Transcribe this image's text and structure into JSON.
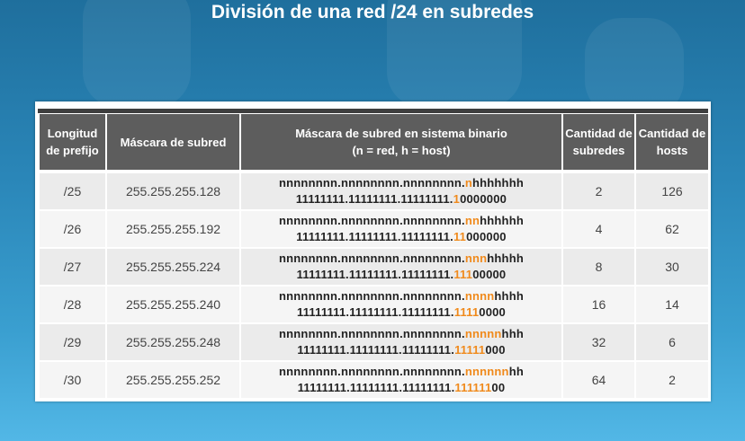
{
  "title": "División de una red /24 en subredes",
  "headers": {
    "prefix": "Longitud de prefijo",
    "mask": "Máscara de subred",
    "binary_line1": "Máscara de subred en sistema binario",
    "binary_line2": "(n = red, h = host)",
    "subnets": "Cantidad de subredes",
    "hosts": "Cantidad de hosts"
  },
  "rows": [
    {
      "prefix": "/25",
      "mask": "255.255.255.128",
      "net_prefix": "nnnnnnnn.nnnnnnnn.nnnnnnnn.",
      "net_hi": "n",
      "net_rest": "hhhhhhh",
      "bin_prefix": "11111111.11111111.11111111.",
      "bin_hi": "1",
      "bin_rest": "0000000",
      "subnets": "2",
      "hosts": "126"
    },
    {
      "prefix": "/26",
      "mask": "255.255.255.192",
      "net_prefix": "nnnnnnnn.nnnnnnnn.nnnnnnnn.",
      "net_hi": "nn",
      "net_rest": "hhhhhh",
      "bin_prefix": "11111111.11111111.11111111.",
      "bin_hi": "11",
      "bin_rest": "000000",
      "subnets": "4",
      "hosts": "62"
    },
    {
      "prefix": "/27",
      "mask": "255.255.255.224",
      "net_prefix": "nnnnnnnn.nnnnnnnn.nnnnnnnn.",
      "net_hi": "nnn",
      "net_rest": "hhhhh",
      "bin_prefix": "11111111.11111111.11111111.",
      "bin_hi": "111",
      "bin_rest": "00000",
      "subnets": "8",
      "hosts": "30"
    },
    {
      "prefix": "/28",
      "mask": "255.255.255.240",
      "net_prefix": "nnnnnnnn.nnnnnnnn.nnnnnnnn.",
      "net_hi": "nnnn",
      "net_rest": "hhhh",
      "bin_prefix": "11111111.11111111.11111111.",
      "bin_hi": "1111",
      "bin_rest": "0000",
      "subnets": "16",
      "hosts": "14"
    },
    {
      "prefix": "/29",
      "mask": "255.255.255.248",
      "net_prefix": "nnnnnnnn.nnnnnnnn.nnnnnnnn.",
      "net_hi": "nnnnn",
      "net_rest": "hhh",
      "bin_prefix": "11111111.11111111.11111111.",
      "bin_hi": "11111",
      "bin_rest": "000",
      "subnets": "32",
      "hosts": "6"
    },
    {
      "prefix": "/30",
      "mask": "255.255.255.252",
      "net_prefix": "nnnnnnnn.nnnnnnnn.nnnnnnnn.",
      "net_hi": "nnnnnn",
      "net_rest": "hh",
      "bin_prefix": "11111111.11111111.11111111.",
      "bin_hi": "111111",
      "bin_rest": "00",
      "subnets": "64",
      "hosts": "2"
    }
  ],
  "colors": {
    "highlight": "#f08a1c",
    "header_bg": "#5d5d5d"
  }
}
